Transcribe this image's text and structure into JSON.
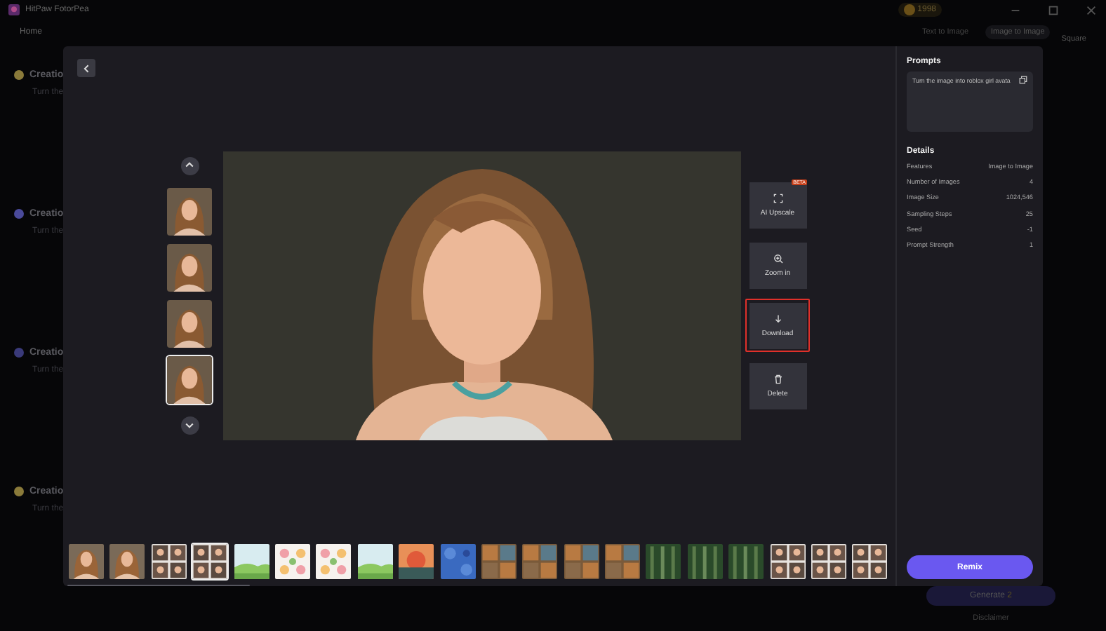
{
  "app": {
    "title": "HitPaw FotorPea",
    "coins": "1998",
    "nav": "Home",
    "modes": [
      {
        "label": "Text to Image",
        "selected": false
      },
      {
        "label": "Image to Image",
        "selected": true
      }
    ],
    "aspect": "Square"
  },
  "history": [
    {
      "title": "Creatio",
      "prompt": "Turn the",
      "color": "#8a7a3a"
    },
    {
      "title": "Creatio",
      "prompt": "Turn the",
      "color": "#4a4a9a"
    },
    {
      "title": "Creatio",
      "prompt": "Turn the",
      "color": "#3a3a7a"
    },
    {
      "title": "Creatio",
      "prompt": "Turn the",
      "color": "#8a7a3a"
    }
  ],
  "generate": {
    "label": "Generate",
    "cost": "2"
  },
  "disclaimer": "Disclaimer",
  "viewer": {
    "thumbnails": [
      {
        "selected": false
      },
      {
        "selected": false
      },
      {
        "selected": false
      },
      {
        "selected": true
      }
    ],
    "actions": [
      {
        "kind": "upscale",
        "label": "AI Upscale",
        "badge": "BETA",
        "highlighted": false
      },
      {
        "kind": "zoom",
        "label": "Zoom in",
        "highlighted": false
      },
      {
        "kind": "download",
        "label": "Download",
        "highlighted": true
      },
      {
        "kind": "delete",
        "label": "Delete",
        "highlighted": false
      }
    ]
  },
  "prompts": {
    "title": "Prompts",
    "text": "Turn the image into roblox girl avata"
  },
  "details": {
    "title": "Details",
    "rows": [
      {
        "label": "Features",
        "value": "Image to Image"
      },
      {
        "label": "Number of Images",
        "value": "4"
      },
      {
        "label": "Image Size",
        "value": "1024,546"
      },
      {
        "label": "Sampling Steps",
        "value": "25"
      },
      {
        "label": "Seed",
        "value": "-1"
      },
      {
        "label": "Prompt Strength",
        "value": "1"
      }
    ]
  },
  "gallery": [
    {
      "kind": "portrait",
      "selected": false
    },
    {
      "kind": "portrait",
      "selected": false
    },
    {
      "kind": "grid",
      "selected": false
    },
    {
      "kind": "grid",
      "selected": true
    },
    {
      "kind": "landscape",
      "selected": false
    },
    {
      "kind": "flowers",
      "selected": false
    },
    {
      "kind": "flowers",
      "selected": false
    },
    {
      "kind": "landscape",
      "selected": false
    },
    {
      "kind": "sunset",
      "selected": false
    },
    {
      "kind": "pattern",
      "selected": false
    },
    {
      "kind": "art",
      "selected": false
    },
    {
      "kind": "art",
      "selected": false
    },
    {
      "kind": "art",
      "selected": false
    },
    {
      "kind": "art",
      "selected": false
    },
    {
      "kind": "forest",
      "selected": false
    },
    {
      "kind": "forest",
      "selected": false
    },
    {
      "kind": "forest",
      "selected": false
    },
    {
      "kind": "grid",
      "selected": false
    },
    {
      "kind": "grid",
      "selected": false
    },
    {
      "kind": "grid",
      "selected": false
    }
  ],
  "remix": "Remix"
}
